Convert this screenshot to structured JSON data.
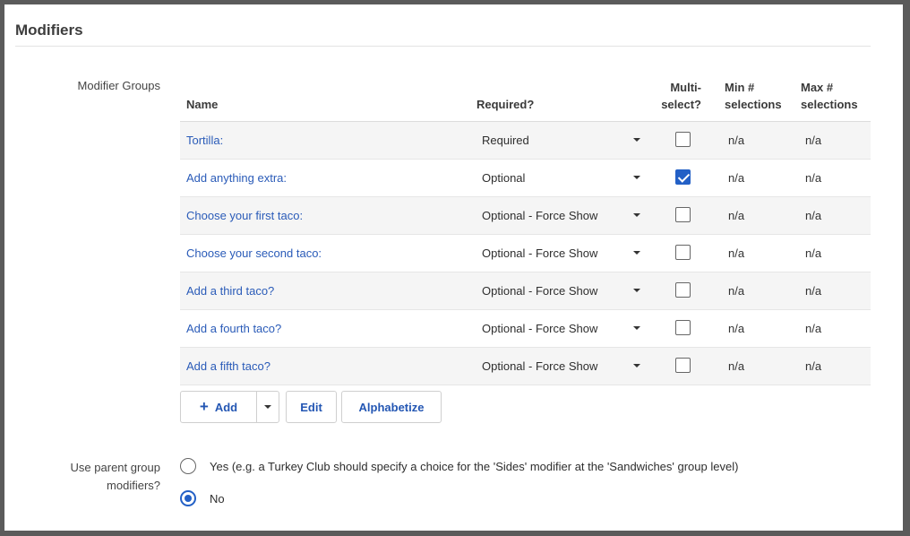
{
  "section": {
    "title": "Modifiers"
  },
  "groups_label": "Modifier Groups",
  "table": {
    "headers": {
      "name": "Name",
      "required": "Required?",
      "multi": "Multi-\nselect?",
      "min": "Min #\nselections",
      "max": "Max #\nselections"
    },
    "rows": [
      {
        "name": "Tortilla:",
        "required": "Required",
        "multi": false,
        "min": "n/a",
        "max": "n/a"
      },
      {
        "name": "Add anything extra:",
        "required": "Optional",
        "multi": true,
        "min": "n/a",
        "max": "n/a"
      },
      {
        "name": "Choose your first taco:",
        "required": "Optional - Force Show",
        "multi": false,
        "min": "n/a",
        "max": "n/a"
      },
      {
        "name": "Choose your second taco:",
        "required": "Optional - Force Show",
        "multi": false,
        "min": "n/a",
        "max": "n/a"
      },
      {
        "name": "Add a third taco?",
        "required": "Optional - Force Show",
        "multi": false,
        "min": "n/a",
        "max": "n/a"
      },
      {
        "name": "Add a fourth taco?",
        "required": "Optional - Force Show",
        "multi": false,
        "min": "n/a",
        "max": "n/a"
      },
      {
        "name": "Add a fifth taco?",
        "required": "Optional - Force Show",
        "multi": false,
        "min": "n/a",
        "max": "n/a"
      }
    ]
  },
  "buttons": {
    "add_icon": "+",
    "add": "Add",
    "edit": "Edit",
    "alphabetize": "Alphabetize"
  },
  "parent": {
    "label": "Use parent group\nmodifiers?",
    "options": [
      {
        "label": "Yes (e.g. a Turkey Club should specify a choice for the 'Sides' modifier at the 'Sandwiches' group level)",
        "selected": false
      },
      {
        "label": "No",
        "selected": true
      }
    ]
  },
  "colors": {
    "accent": "#2360c6",
    "link": "#2a5bb8"
  }
}
